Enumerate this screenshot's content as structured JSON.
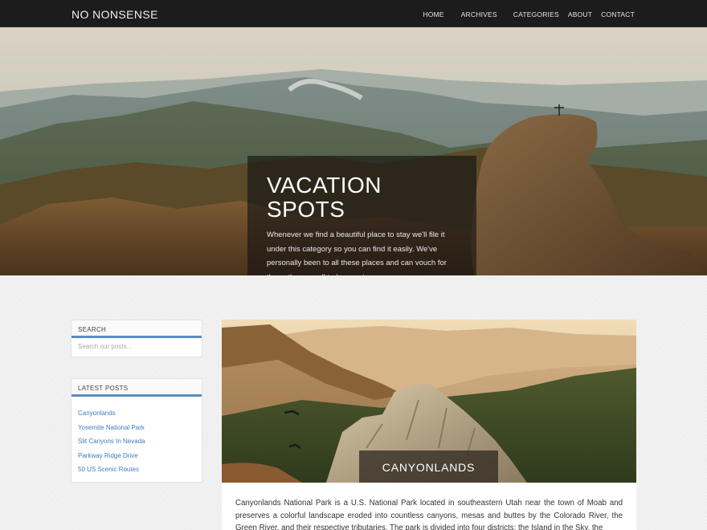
{
  "site": {
    "brand": "NO NONSENSE"
  },
  "nav": {
    "items": [
      {
        "label": "HOME"
      },
      {
        "label": "ARCHIVES"
      },
      {
        "label": "CATEGORIES"
      },
      {
        "label": "ABOUT"
      },
      {
        "label": "CONTACT"
      }
    ]
  },
  "hero": {
    "title": "VACATION SPOTS",
    "description": "Whenever we find a beautiful place to stay we'll file it under this category so you can find it easily. We've personally been to all these places and can vouch for them, they are all truly amazing"
  },
  "sidebar": {
    "search": {
      "heading": "SEARCH",
      "placeholder": "Search our posts..."
    },
    "latest": {
      "heading": "LATEST POSTS",
      "items": [
        {
          "label": "Canyonlands"
        },
        {
          "label": "Yosemite National Park"
        },
        {
          "label": "Slit Canyons In Nevada"
        },
        {
          "label": "Parkway Ridge Drive"
        },
        {
          "label": "50 US Scenic Routes"
        }
      ]
    }
  },
  "post": {
    "title": "CANYONLANDS",
    "excerpt": "Canyonlands National Park is a U.S. National Park located in southeastern Utah near the town of Moab and preserves a colorful landscape eroded into countless canyons, mesas and buttes by the Colorado River, the Green River, and their respective tributaries. The park is divided into four districts: the Island in the Sky, the"
  },
  "colors": {
    "navbar_bg": "#1c1c1c",
    "accent": "#5b8cc4",
    "link": "#3f7fbf"
  }
}
